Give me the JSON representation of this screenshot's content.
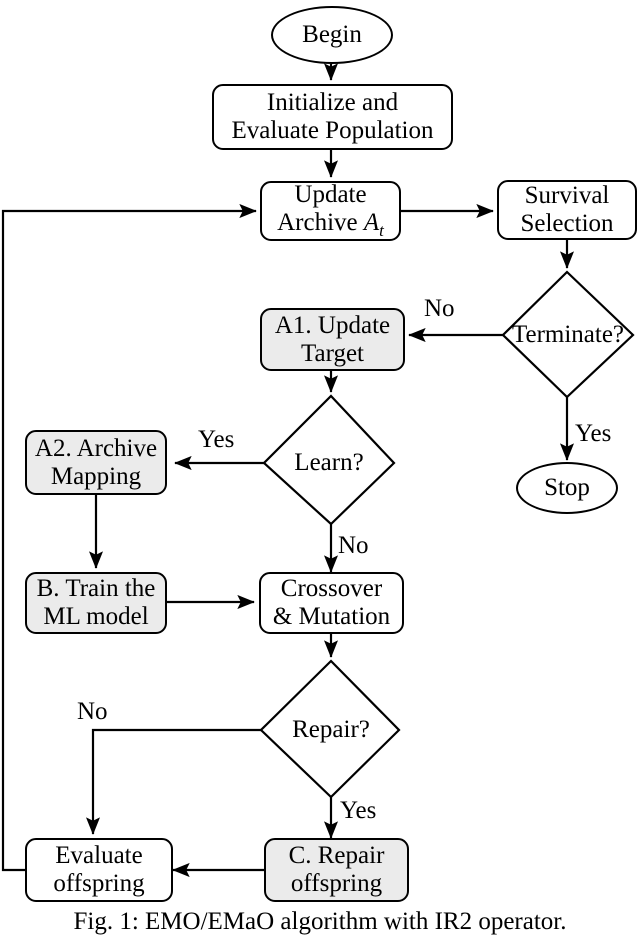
{
  "figure": {
    "caption": "Fig. 1: EMO/EMaO algorithm with IR2 operator."
  },
  "nodes": {
    "begin": {
      "label": "Begin",
      "shape": "ellipse",
      "shaded": false
    },
    "initialize": {
      "label": "Initialize and\nEvaluate Population",
      "shape": "box",
      "shaded": false
    },
    "update_archive": {
      "label_line1": "Update",
      "label_line2_prefix": "Archive ",
      "label_line2_math": "A",
      "label_line2_sub": "t",
      "shape": "box",
      "shaded": false
    },
    "survival_selection": {
      "label": "Survival\nSelection",
      "shape": "box",
      "shaded": false
    },
    "terminate": {
      "label": "Terminate?",
      "shape": "diamond"
    },
    "stop": {
      "label": "Stop",
      "shape": "ellipse",
      "shaded": false
    },
    "a1_update_target": {
      "label": "A1. Update\nTarget",
      "shape": "box",
      "shaded": true
    },
    "learn": {
      "label": "Learn?",
      "shape": "diamond"
    },
    "a2_archive_mapping": {
      "label": "A2. Archive\nMapping",
      "shape": "box",
      "shaded": true
    },
    "b_train_ml": {
      "label": "B. Train the\nML model",
      "shape": "box",
      "shaded": true
    },
    "crossover_mutation": {
      "label": "Crossover\n& Mutation",
      "shape": "box",
      "shaded": false
    },
    "repair": {
      "label": "Repair?",
      "shape": "diamond"
    },
    "c_repair_offspring": {
      "label": "C. Repair\noffspring",
      "shape": "box",
      "shaded": true
    },
    "evaluate_offspring": {
      "label": "Evaluate\noffspring",
      "shape": "box",
      "shaded": false
    }
  },
  "edge_labels": {
    "terminate_no": "No",
    "terminate_yes": "Yes",
    "learn_yes": "Yes",
    "learn_no": "No",
    "repair_no": "No",
    "repair_yes": "Yes"
  },
  "colors": {
    "stroke": "#000000",
    "shaded_fill": "#ebebeb",
    "plain_fill": "#ffffff",
    "background": "#ffffff"
  }
}
